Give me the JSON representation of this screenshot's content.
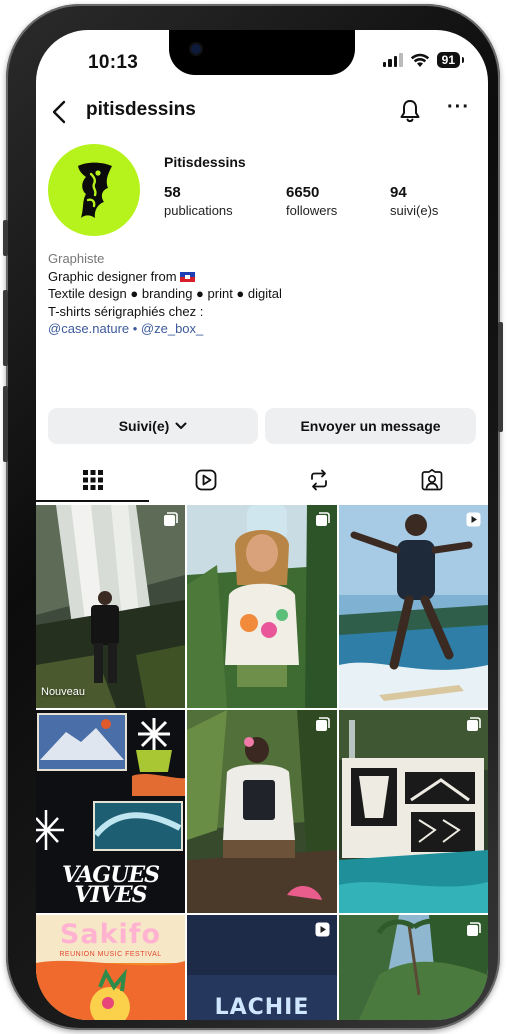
{
  "status": {
    "time": "10:13",
    "battery": "91"
  },
  "header": {
    "username": "pitisdessins"
  },
  "profile": {
    "display_name": "Pitisdessins",
    "stats": [
      {
        "value": "58",
        "label": "publications"
      },
      {
        "value": "6650",
        "label": "followers"
      },
      {
        "value": "94",
        "label": "suivi(e)s"
      }
    ],
    "bio": {
      "category": "Graphiste",
      "line1": "Graphic designer from",
      "line2": "Textile design ● branding ● print ● digital",
      "line3": "T-shirts sérigraphiés chez :",
      "link1": "@case.nature",
      "separator": " • ",
      "link2": "@ze_box_"
    }
  },
  "actions": {
    "follow_label": "Suivi(e)",
    "message_label": "Envoyer un message"
  },
  "tabs": [
    "grid",
    "reels",
    "reposts",
    "tagged"
  ],
  "grid": {
    "caption_first": "Nouveau",
    "poster_sakifo": "Sakifo",
    "poster_sakifo_sub": "REUNION MUSIC FESTIVAL",
    "poster_lachie": "LACHIE",
    "poster_vagues": "VAGUES VIVES"
  },
  "colors": {
    "accent_link": "#3d5a9c",
    "avatar_bg": "#b6f21b",
    "button_bg": "#eeeff1"
  }
}
